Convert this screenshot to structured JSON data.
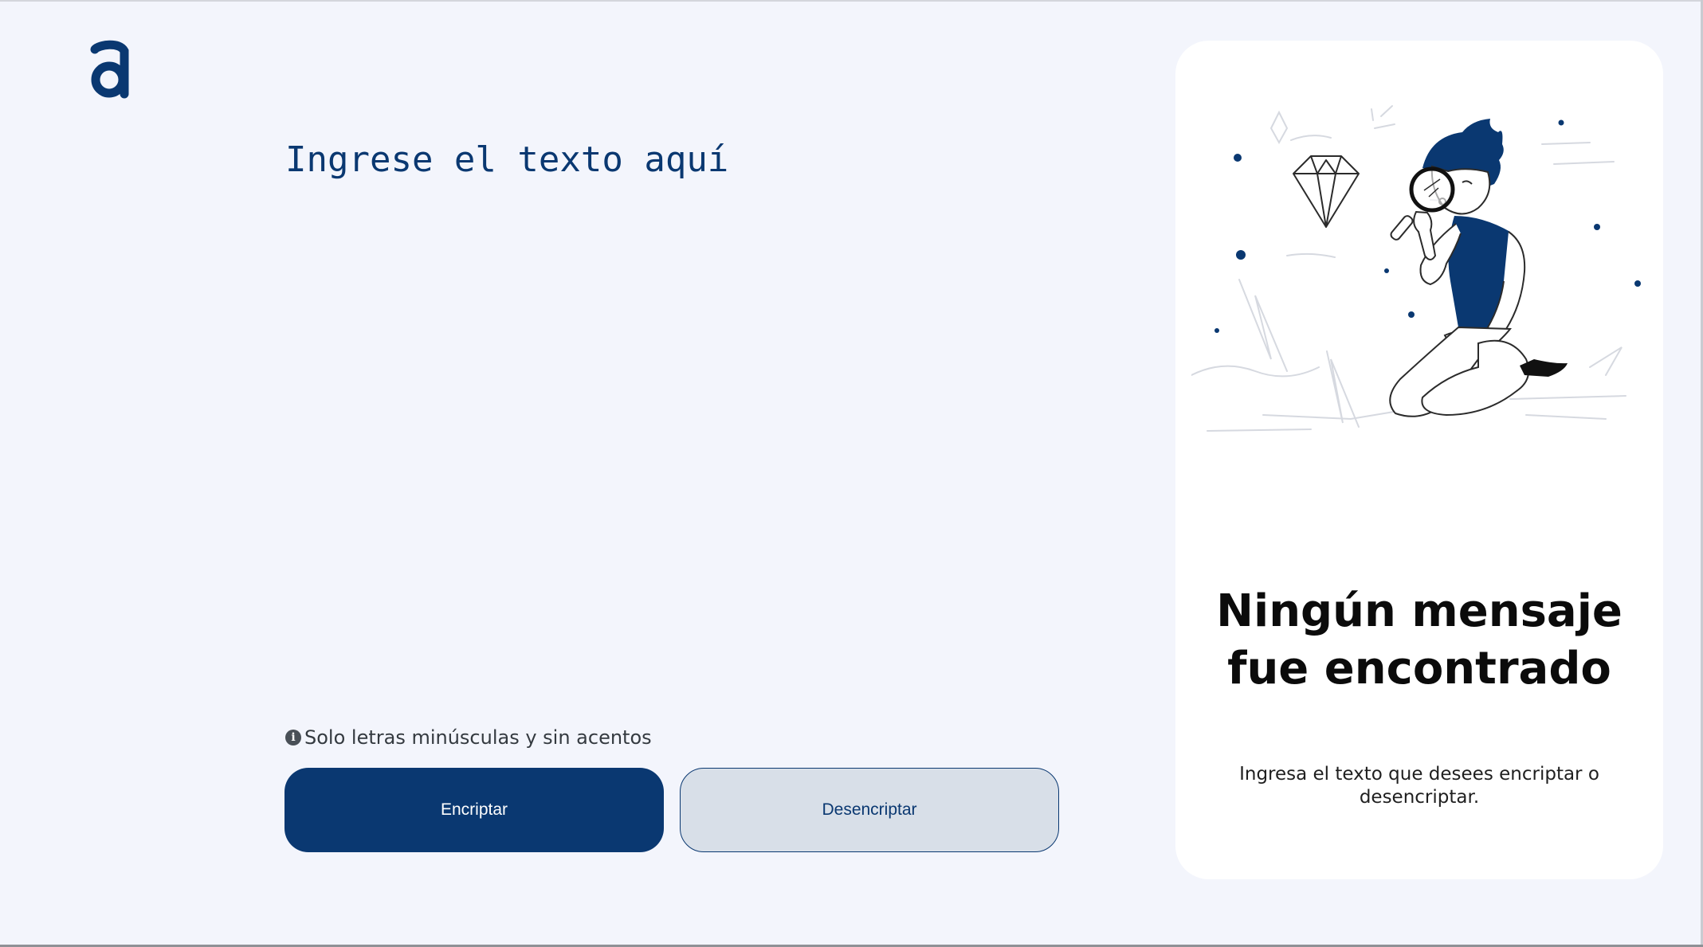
{
  "input": {
    "placeholder": "Ingrese el texto aquí"
  },
  "hint": {
    "icon": "info-circle-icon",
    "text": "Solo letras minúsculas y sin acentos"
  },
  "buttons": {
    "encrypt_label": "Encriptar",
    "decrypt_label": "Desencriptar"
  },
  "output_panel": {
    "title": "Ningún mensaje fue encontrado",
    "description": "Ingresa el texto que desees encriptar o desencriptar."
  },
  "colors": {
    "background": "#f3f5fc",
    "primary": "#0a3871",
    "secondary_button_bg": "#d8dfe8",
    "panel_bg": "#ffffff"
  }
}
